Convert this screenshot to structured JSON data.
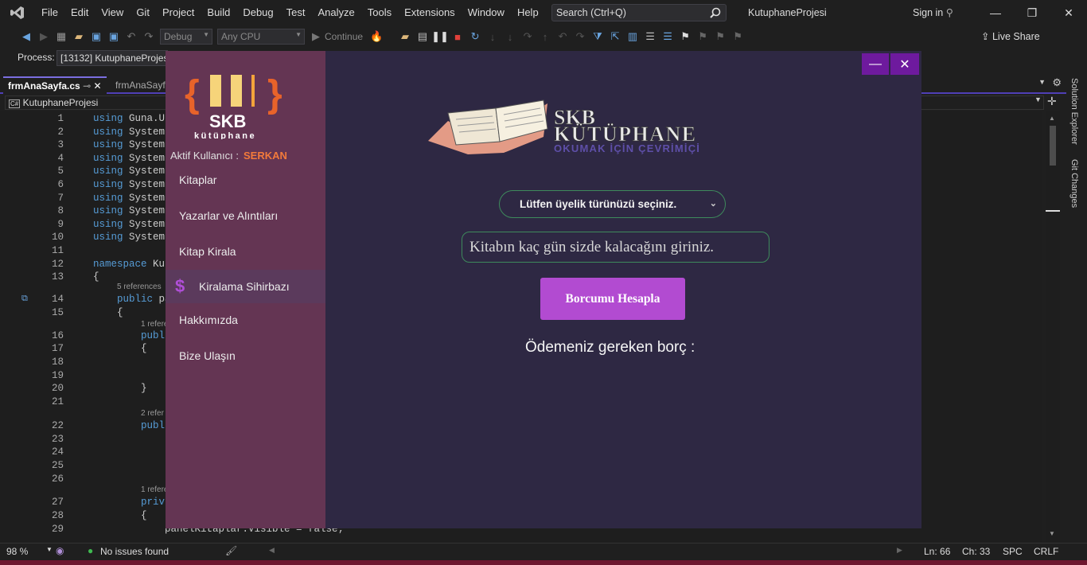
{
  "ide": {
    "menu": [
      "File",
      "Edit",
      "View",
      "Git",
      "Project",
      "Build",
      "Debug",
      "Test",
      "Analyze",
      "Tools",
      "Extensions",
      "Window",
      "Help"
    ],
    "search_placeholder": "Search (Ctrl+Q)",
    "project_name": "KutuphaneProjesi",
    "sign_in": "Sign in",
    "config": "Debug",
    "platform": "Any CPU",
    "continue_label": "Continue",
    "live_share": "Live Share",
    "process_label": "Process:",
    "process_value": "[13132] KutuphaneProjesi",
    "tabs": [
      "frmAnaSayfa.cs",
      "frmAnaSayfa"
    ],
    "nav_project": "KutuphaneProjesi",
    "solution_explorer": "Solution Explorer",
    "git_changes": "Git Changes",
    "code_lines": [
      {
        "n": "1",
        "t": "using Guna.UI",
        "kw": "using"
      },
      {
        "n": "2",
        "t": "using System",
        "kw": "using"
      },
      {
        "n": "3",
        "t": "using System",
        "kw": "using"
      },
      {
        "n": "4",
        "t": "using System",
        "kw": "using"
      },
      {
        "n": "5",
        "t": "using System",
        "kw": "using"
      },
      {
        "n": "6",
        "t": "using System",
        "kw": "using"
      },
      {
        "n": "7",
        "t": "using System",
        "kw": "using"
      },
      {
        "n": "8",
        "t": "using System",
        "kw": "using"
      },
      {
        "n": "9",
        "t": "using System",
        "kw": "using"
      },
      {
        "n": "10",
        "t": "using System",
        "kw": "using"
      },
      {
        "n": "11",
        "t": "",
        "kw": ""
      },
      {
        "n": "12",
        "t": "namespace Ku",
        "kw": "namespace"
      },
      {
        "n": "13",
        "t": "{",
        "kw": ""
      }
    ],
    "code_lines2": [
      {
        "n": "14",
        "t": "    public pa"
      },
      {
        "n": "15",
        "t": "    {"
      },
      {
        "n": "16",
        "t": "        publ"
      },
      {
        "n": "17",
        "t": "        {"
      },
      {
        "n": "18",
        "t": ""
      },
      {
        "n": "19",
        "t": ""
      },
      {
        "n": "20",
        "t": "        }"
      },
      {
        "n": "21",
        "t": ""
      },
      {
        "n": "22",
        "t": "        publ"
      },
      {
        "n": "23",
        "t": ""
      },
      {
        "n": "24",
        "t": ""
      },
      {
        "n": "25",
        "t": ""
      },
      {
        "n": "26",
        "t": ""
      },
      {
        "n": "27",
        "t": "        priv"
      },
      {
        "n": "28",
        "t": "        {"
      },
      {
        "n": "29",
        "t": "            panelKitaplar.Visible = false;"
      }
    ],
    "codelens": [
      "5 references",
      "1 refere",
      "2 refer",
      "1 refere"
    ],
    "zoom": "98 %",
    "issues": "No issues found",
    "ln": "Ln: 66",
    "ch": "Ch: 33",
    "spc": "SPC",
    "crlf": "CRLF"
  },
  "app": {
    "logo_text": "SKB",
    "logo_subtext": "kütüphane",
    "user_label": "Aktif Kullanıcı :",
    "user_name": "SERKAN",
    "menu": [
      "Kitaplar",
      "Yazarlar ve Alıntıları",
      "Kitap Kirala",
      "Kiralama Sihirbazı",
      "Hakkımızda",
      "Bize Ulaşın"
    ],
    "active_menu": "Kiralama Sihirbazı",
    "banner_title": "SKB",
    "banner_title2": "KÜTÜPHANE",
    "banner_sub": "OKUMAK İÇİN ÇEVRİMİÇİ",
    "membership_combo": "Lütfen üyelik türünüzü seçiniz.",
    "days_placeholder": "Kitabın kaç gün sizde kalacağını giriniz.",
    "calc_button": "Borcumu Hesapla",
    "debt_label": "Ödemeniz gereken borç :",
    "colors": {
      "sidebar": "#643553",
      "main": "#2e2843",
      "accent": "#b24bd1",
      "title_buttons": "#6e1a9e",
      "username": "#f27a3b",
      "input_border": "#3e8a5c"
    }
  }
}
